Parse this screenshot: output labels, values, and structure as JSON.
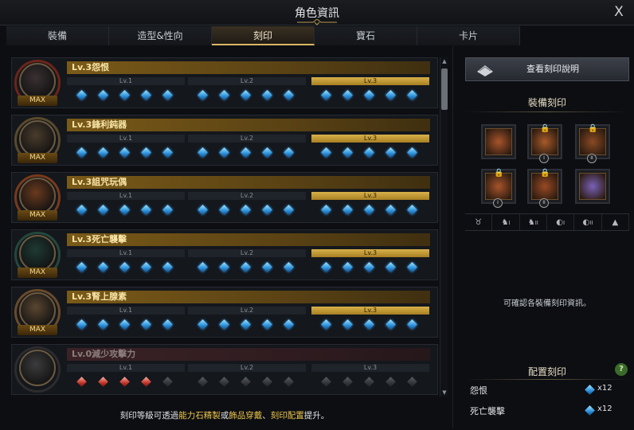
{
  "window": {
    "title": "角色資訊",
    "close_label": "X"
  },
  "tabs": [
    {
      "label": "裝備",
      "active": false
    },
    {
      "label": "造型&性向",
      "active": false
    },
    {
      "label": "刻印",
      "active": true
    },
    {
      "label": "寶石",
      "active": false
    },
    {
      "label": "卡片",
      "active": false
    }
  ],
  "engravings": [
    {
      "name": "Lv.3怨恨",
      "badge": "MAX",
      "active_level": 3,
      "gem_color": "blue",
      "face": "#3a3032",
      "ring": "#6e2418"
    },
    {
      "name": "Lv.3鋒利鈍器",
      "badge": "MAX",
      "active_level": 3,
      "gem_color": "blue",
      "face": "#4a3c2c",
      "ring": "#5a4a2a"
    },
    {
      "name": "Lv.3詛咒玩偶",
      "badge": "MAX",
      "active_level": 3,
      "gem_color": "blue",
      "face": "#6a3a1e",
      "ring": "#7a3a1a"
    },
    {
      "name": "Lv.3死亡襲擊",
      "badge": "MAX",
      "active_level": 3,
      "gem_color": "blue",
      "face": "#1e3a34",
      "ring": "#24483c"
    },
    {
      "name": "Lv.3腎上腺素",
      "badge": "MAX",
      "active_level": 3,
      "gem_color": "blue",
      "face": "#5a4630",
      "ring": "#6a4a2a"
    },
    {
      "name": "Lv.0減少攻擊力",
      "badge": "",
      "active_level": 0,
      "gem_color": "red",
      "face": "#3c3c3e",
      "ring": "#2c2c2e"
    }
  ],
  "level_labels": [
    "Lv.1",
    "Lv.2",
    "Lv.3"
  ],
  "footer": {
    "p1": "刻印等級可透過",
    "h1": "能力石精製",
    "p2": "或",
    "h2": "飾品穿戴",
    "p3": "、",
    "h3": "刻印配置",
    "p4": "提升。"
  },
  "right": {
    "view_button": "查看刻印說明",
    "equip_title": "裝備刻印",
    "equip_slots": [
      {
        "name": "necklace",
        "locked": false,
        "badge": "",
        "color": "#a8542a"
      },
      {
        "name": "earring-1",
        "locked": true,
        "badge": "I",
        "color": "#a85a2a"
      },
      {
        "name": "earring-2",
        "locked": true,
        "badge": "II",
        "color": "#8a4a24"
      },
      {
        "name": "ring-1",
        "locked": true,
        "badge": "I",
        "color": "#a8542a"
      },
      {
        "name": "ring-2",
        "locked": true,
        "badge": "II",
        "color": "#9a4a24"
      },
      {
        "name": "stone",
        "locked": false,
        "badge": "",
        "color": "#7a62b8"
      }
    ],
    "slot_icons": [
      "necklace",
      "earring I",
      "earring II",
      "ring I",
      "ring II",
      "stone"
    ],
    "slot_marks": [
      "",
      "I",
      "II",
      "I",
      "II",
      ""
    ],
    "info_text": "可確認各裝備刻印資訊。",
    "config_title": "配置刻印",
    "help_label": "?",
    "config_items": [
      {
        "name": "怨恨",
        "count": "x12"
      },
      {
        "name": "死亡襲擊",
        "count": "x12"
      }
    ]
  }
}
